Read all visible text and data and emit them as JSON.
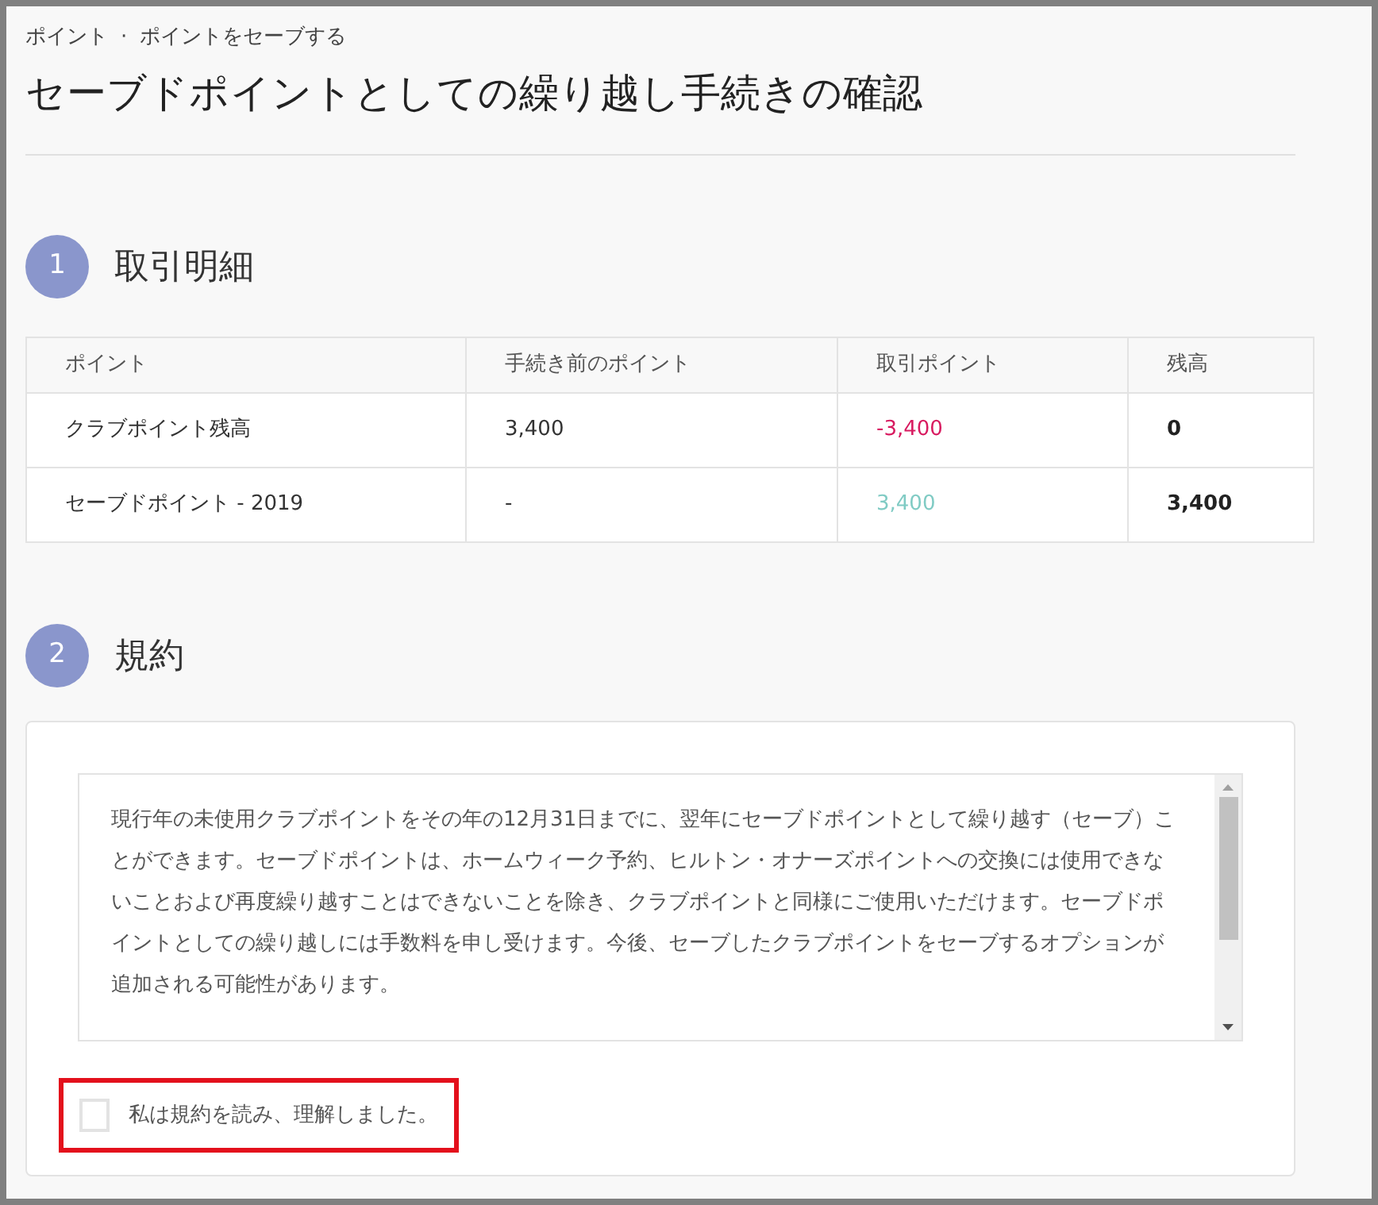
{
  "breadcrumb": {
    "items": [
      "ポイント",
      "ポイントをセーブする"
    ],
    "separator": "·"
  },
  "title": "セーブドポイントとしての繰り越し手続きの確認",
  "sections": [
    {
      "number": "1",
      "heading": "取引明細"
    },
    {
      "number": "2",
      "heading": "規約"
    }
  ],
  "table": {
    "columns": [
      "ポイント",
      "手続き前のポイント",
      "取引ポイント",
      "残高"
    ],
    "rows": [
      [
        {
          "text": "クラブポイント残高",
          "kind": "plain"
        },
        {
          "text": "3,400",
          "kind": "plain"
        },
        {
          "text": "-3,400",
          "kind": "negative"
        },
        {
          "text": "0",
          "kind": "bold"
        }
      ],
      [
        {
          "text": "セーブドポイント - 2019",
          "kind": "plain"
        },
        {
          "text": "-",
          "kind": "plain"
        },
        {
          "text": "3,400",
          "kind": "positive"
        },
        {
          "text": "3,400",
          "kind": "bold"
        }
      ]
    ]
  },
  "terms": {
    "paragraph": "現行年の未使用クラブポイントをその年の12月31日までに、翌年にセーブドポイントとして繰り越す（セーブ）ことができます。セーブドポイントは、ホームウィーク予約、ヒルトン・オナーズポイントへの交換には使用できないことおよび再度繰り越すことはできないことを除き、クラブポイントと同様にご使用いただけます。セーブドポイントとしての繰り越しには手数料を申し受けます。今後、セーブしたクラブポイントをセーブするオプションが追加される可能性があります。"
  },
  "agreement": {
    "label": "私は規約を読み、理解しました。",
    "checked": false,
    "highlighted": true
  }
}
